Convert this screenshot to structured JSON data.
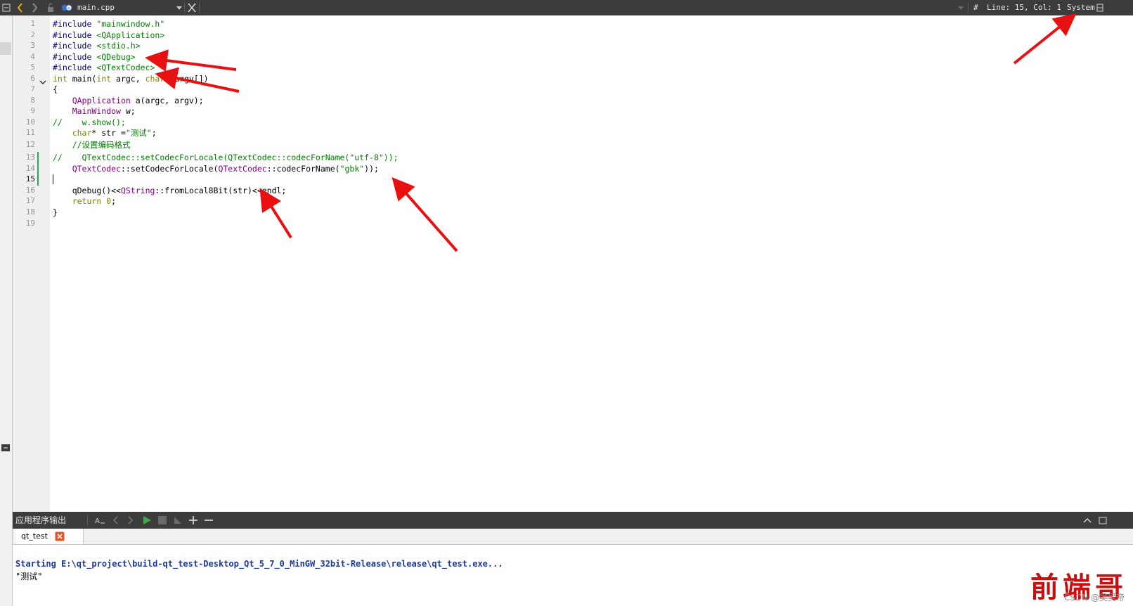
{
  "topbar": {
    "filename": "main.cpp",
    "hash": "#",
    "line_col": "Line: 15, Col: 1",
    "encoding": "System"
  },
  "gutter": {
    "line_numbers": [
      "1",
      "2",
      "3",
      "4",
      "5",
      "6",
      "7",
      "8",
      "9",
      "10",
      "11",
      "12",
      "13",
      "14",
      "15",
      "16",
      "17",
      "18",
      "19"
    ]
  },
  "code": {
    "l1": {
      "pp": "#include",
      "str": " \"mainwindow.h\""
    },
    "l2": {
      "pp": "#include",
      "str": " <QApplication>"
    },
    "l3": {
      "pp": "#include",
      "str": " <stdio.h>"
    },
    "l4": {
      "pp": "#include",
      "str": " <QDebug>"
    },
    "l5": {
      "pp": "#include",
      "str": " <QTextCodec>"
    },
    "l6": {
      "a": "int",
      "b": " main(",
      "c": "int",
      "d": " argc, ",
      "e": "char",
      "f": " *argv[])"
    },
    "l7": "{",
    "l8": {
      "indent": "    ",
      "cls": "QApplication",
      "rest": " a(argc, argv);"
    },
    "l9": {
      "indent": "    ",
      "cls": "MainWindow",
      "rest": " w;"
    },
    "l10": "//    w.show();",
    "l11": {
      "indent": "    ",
      "kw": "char",
      "rest": "* str =",
      "str": "\"测试\"",
      "end": ";"
    },
    "l12": "    //设置编码格式",
    "l13": "//    QTextCodec::setCodecForLocale(QTextCodec::codecForName(\"utf-8\"));",
    "l14": {
      "indent": "    ",
      "cls1": "QTextCodec",
      "mid": "::setCodecForLocale(",
      "cls2": "QTextCodec",
      "mid2": "::codecForName(",
      "str": "\"gbk\"",
      "end": "));"
    },
    "l16": {
      "indent": "    ",
      "a": "qDebug()<<",
      "cls": "QString",
      "b": "::fromLocal8Bit(str)<<endl;"
    },
    "l17": {
      "indent": "    ",
      "kw": "return",
      "num": " 0",
      "end": ";"
    },
    "l18": "}"
  },
  "bottom": {
    "panel_title": "应用程序输出",
    "tab_label": "qt_test",
    "output_line1": "Starting E:\\qt_project\\build-qt_test-Desktop_Qt_5_7_0_MinGW_32bit-Release\\release\\qt_test.exe...",
    "output_line2": "\"测试\""
  },
  "watermark": {
    "logo_text": "前端哥",
    "credit": "CSDN @吴吴帝"
  },
  "colors": {
    "annotation_arrow": "#e81010",
    "toolbar_bg": "#3c3c3c",
    "run_green": "#43a843",
    "tab_close": "#e0582a"
  }
}
